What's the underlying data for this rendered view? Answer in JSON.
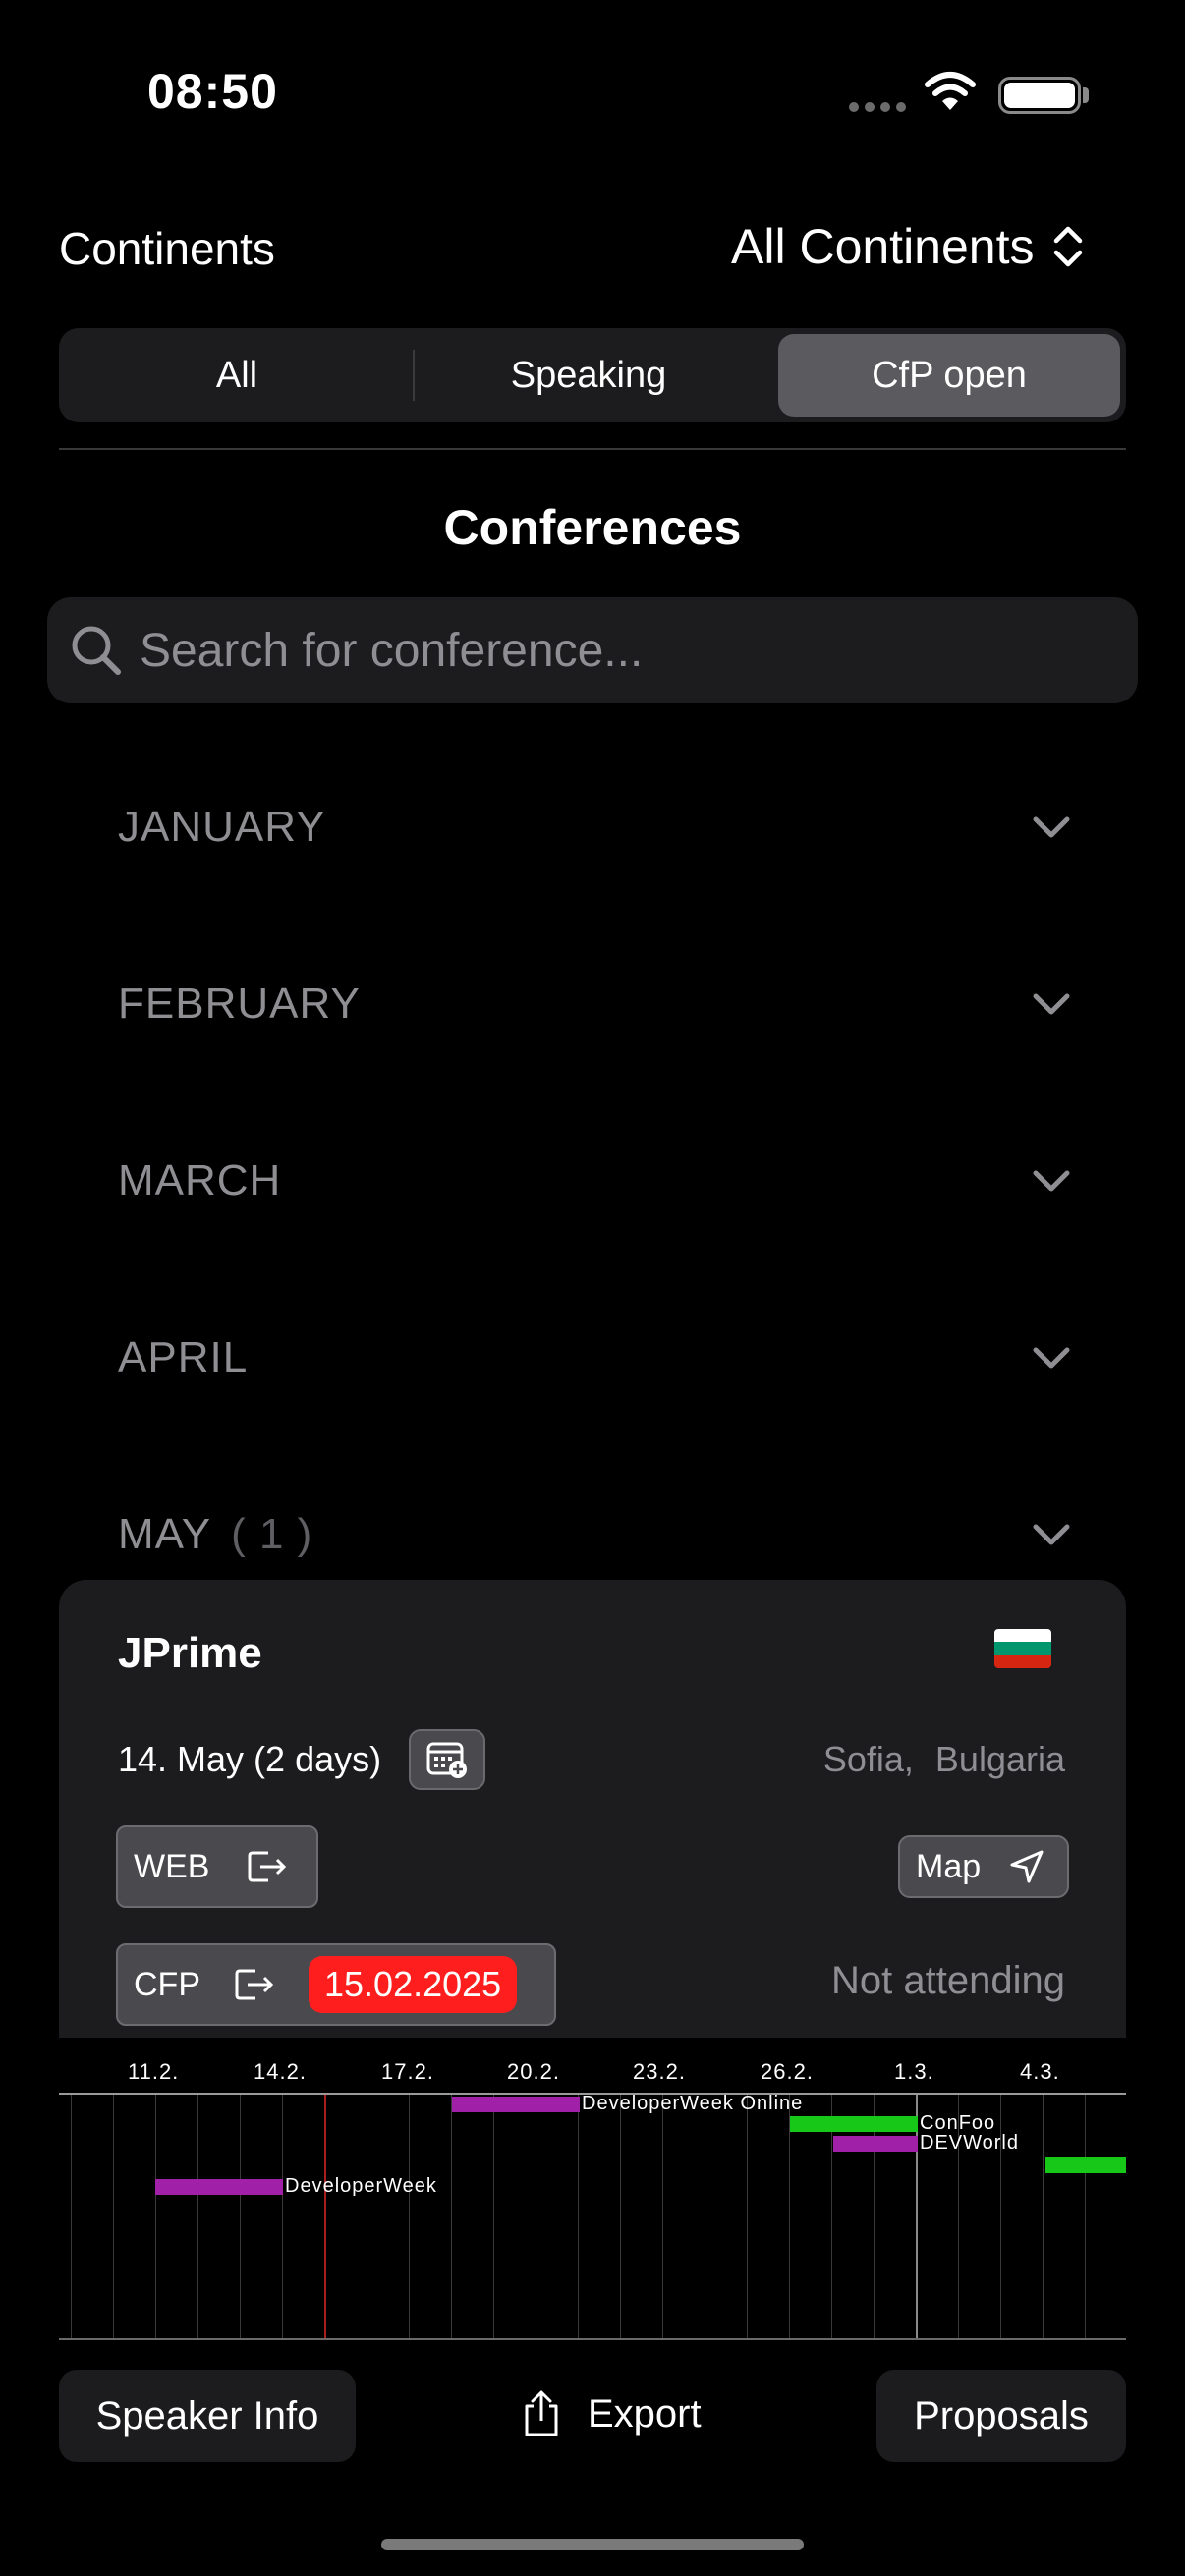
{
  "status": {
    "time": "08:50"
  },
  "continents": {
    "label": "Continents",
    "selected": "All Continents"
  },
  "filter": {
    "segments": [
      "All",
      "Speaking",
      "CfP open"
    ],
    "active_index": 2
  },
  "section": {
    "title": "Conferences"
  },
  "search": {
    "placeholder": "Search for conference..."
  },
  "months": [
    {
      "name": "JANUARY",
      "count": ""
    },
    {
      "name": "FEBRUARY",
      "count": ""
    },
    {
      "name": "MARCH",
      "count": ""
    },
    {
      "name": "APRIL",
      "count": ""
    },
    {
      "name": "MAY",
      "count": "( 1 )"
    }
  ],
  "card": {
    "title": "JPrime",
    "date": "14. May (2 days)",
    "location": "Sofia,  Bulgaria",
    "web_label": "WEB",
    "map_label": "Map",
    "cfp_label": "CFP",
    "cfp_date": "15.02.2025",
    "attendance": "Not attending",
    "flag_colors": [
      "#ffffff",
      "#00966e",
      "#d62612"
    ]
  },
  "timeline": {
    "labels": [
      "11.2.",
      "14.2.",
      "17.2.",
      "20.2.",
      "23.2.",
      "26.2.",
      "1.3.",
      "4.3."
    ],
    "events": [
      {
        "name": "DeveloperWeek Online",
        "color": "#a020a8"
      },
      {
        "name": "ConFoo",
        "color": "#18c818"
      },
      {
        "name": "DEVWorld",
        "color": "#a020a8"
      },
      {
        "name": "DeveloperWeek",
        "color": "#a020a8"
      },
      {
        "name": "",
        "color": "#18c818"
      }
    ]
  },
  "toolbar": {
    "speaker_info": "Speaker Info",
    "export": "Export",
    "proposals": "Proposals"
  },
  "colors": {
    "cfp_badge": "#ff1e1e",
    "today_line": "#a8201e",
    "card_bg": "#1c1c1e"
  }
}
